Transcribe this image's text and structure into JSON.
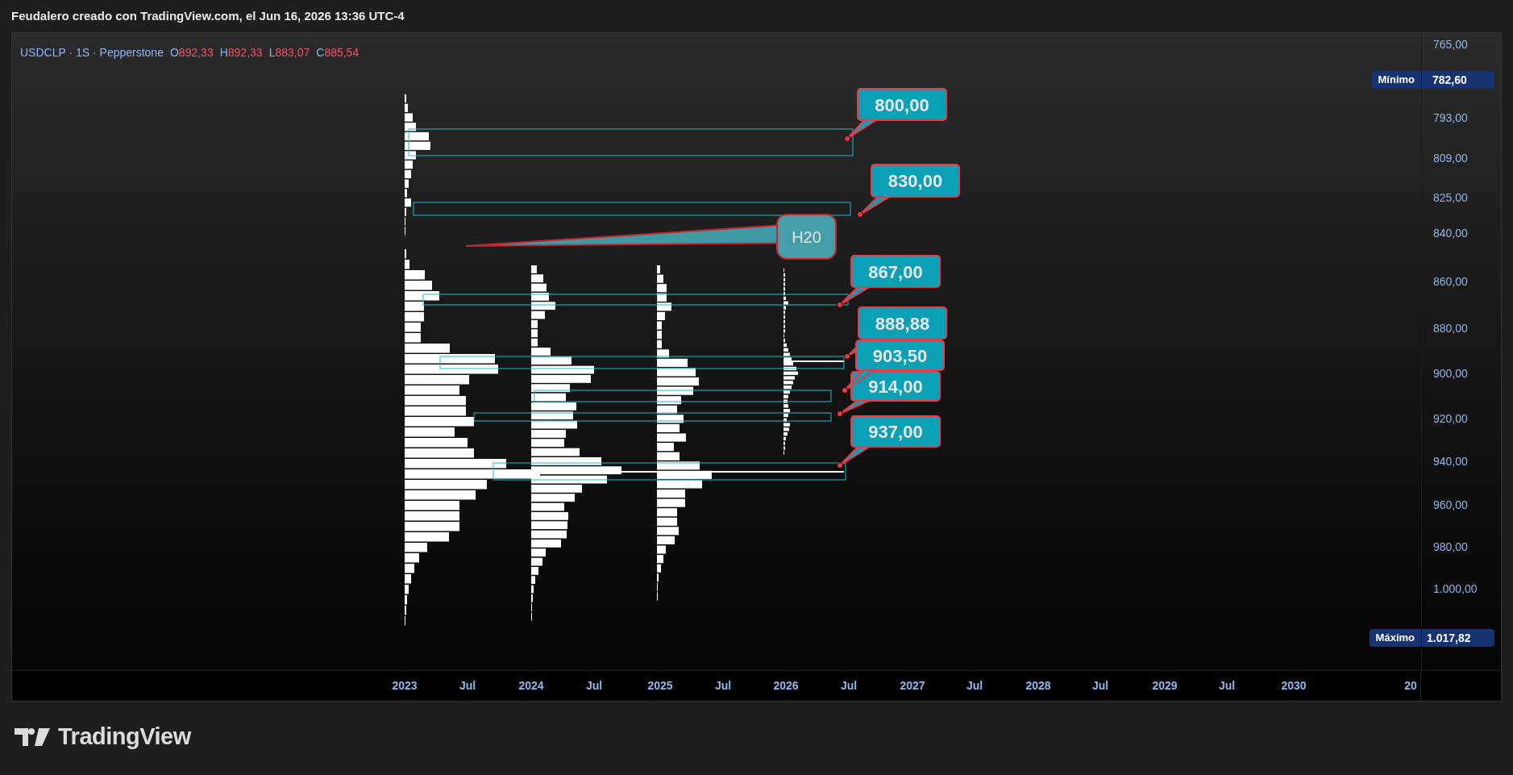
{
  "header": {
    "title": "Feudalero creado con TradingView.com, el Jun 16, 2026 13:36 UTC-4"
  },
  "legend": {
    "symbol": "USDCLP · 1S · Pepperstone",
    "ohlc": [
      {
        "key": "O",
        "value": "892,33"
      },
      {
        "key": "H",
        "value": "892,33"
      },
      {
        "key": "L",
        "value": "883,07"
      },
      {
        "key": "C",
        "value": "885,54"
      }
    ]
  },
  "chart": {
    "callouts": [
      {
        "kind": "price",
        "text": "800,00"
      },
      {
        "kind": "price",
        "text": "830,00"
      },
      {
        "kind": "note",
        "text": "H20"
      },
      {
        "kind": "price",
        "text": "867,00"
      },
      {
        "kind": "price",
        "text": "888,88"
      },
      {
        "kind": "price",
        "text": "903,50"
      },
      {
        "kind": "price",
        "text": "914,00"
      },
      {
        "kind": "price",
        "text": "937,00"
      }
    ],
    "price_axis": {
      "labels": [
        "765,00",
        "793,00",
        "809,00",
        "825,00",
        "840,00",
        "860,00",
        "880,00",
        "900,00",
        "920,00",
        "940,00",
        "960,00",
        "980,00",
        "1.000,00"
      ],
      "min_marker": {
        "label": "Mínimo",
        "value": "782,60"
      },
      "max_marker": {
        "label": "Máximo",
        "value": "1.017,82"
      }
    },
    "time_axis": {
      "labels": [
        "2023",
        "Jul",
        "2024",
        "Jul",
        "2025",
        "Jul",
        "2026",
        "Jul",
        "2027",
        "Jul",
        "2028",
        "Jul",
        "2029",
        "Jul",
        "2030",
        "20"
      ]
    }
  },
  "branding": {
    "logo_text": "TradingView"
  }
}
